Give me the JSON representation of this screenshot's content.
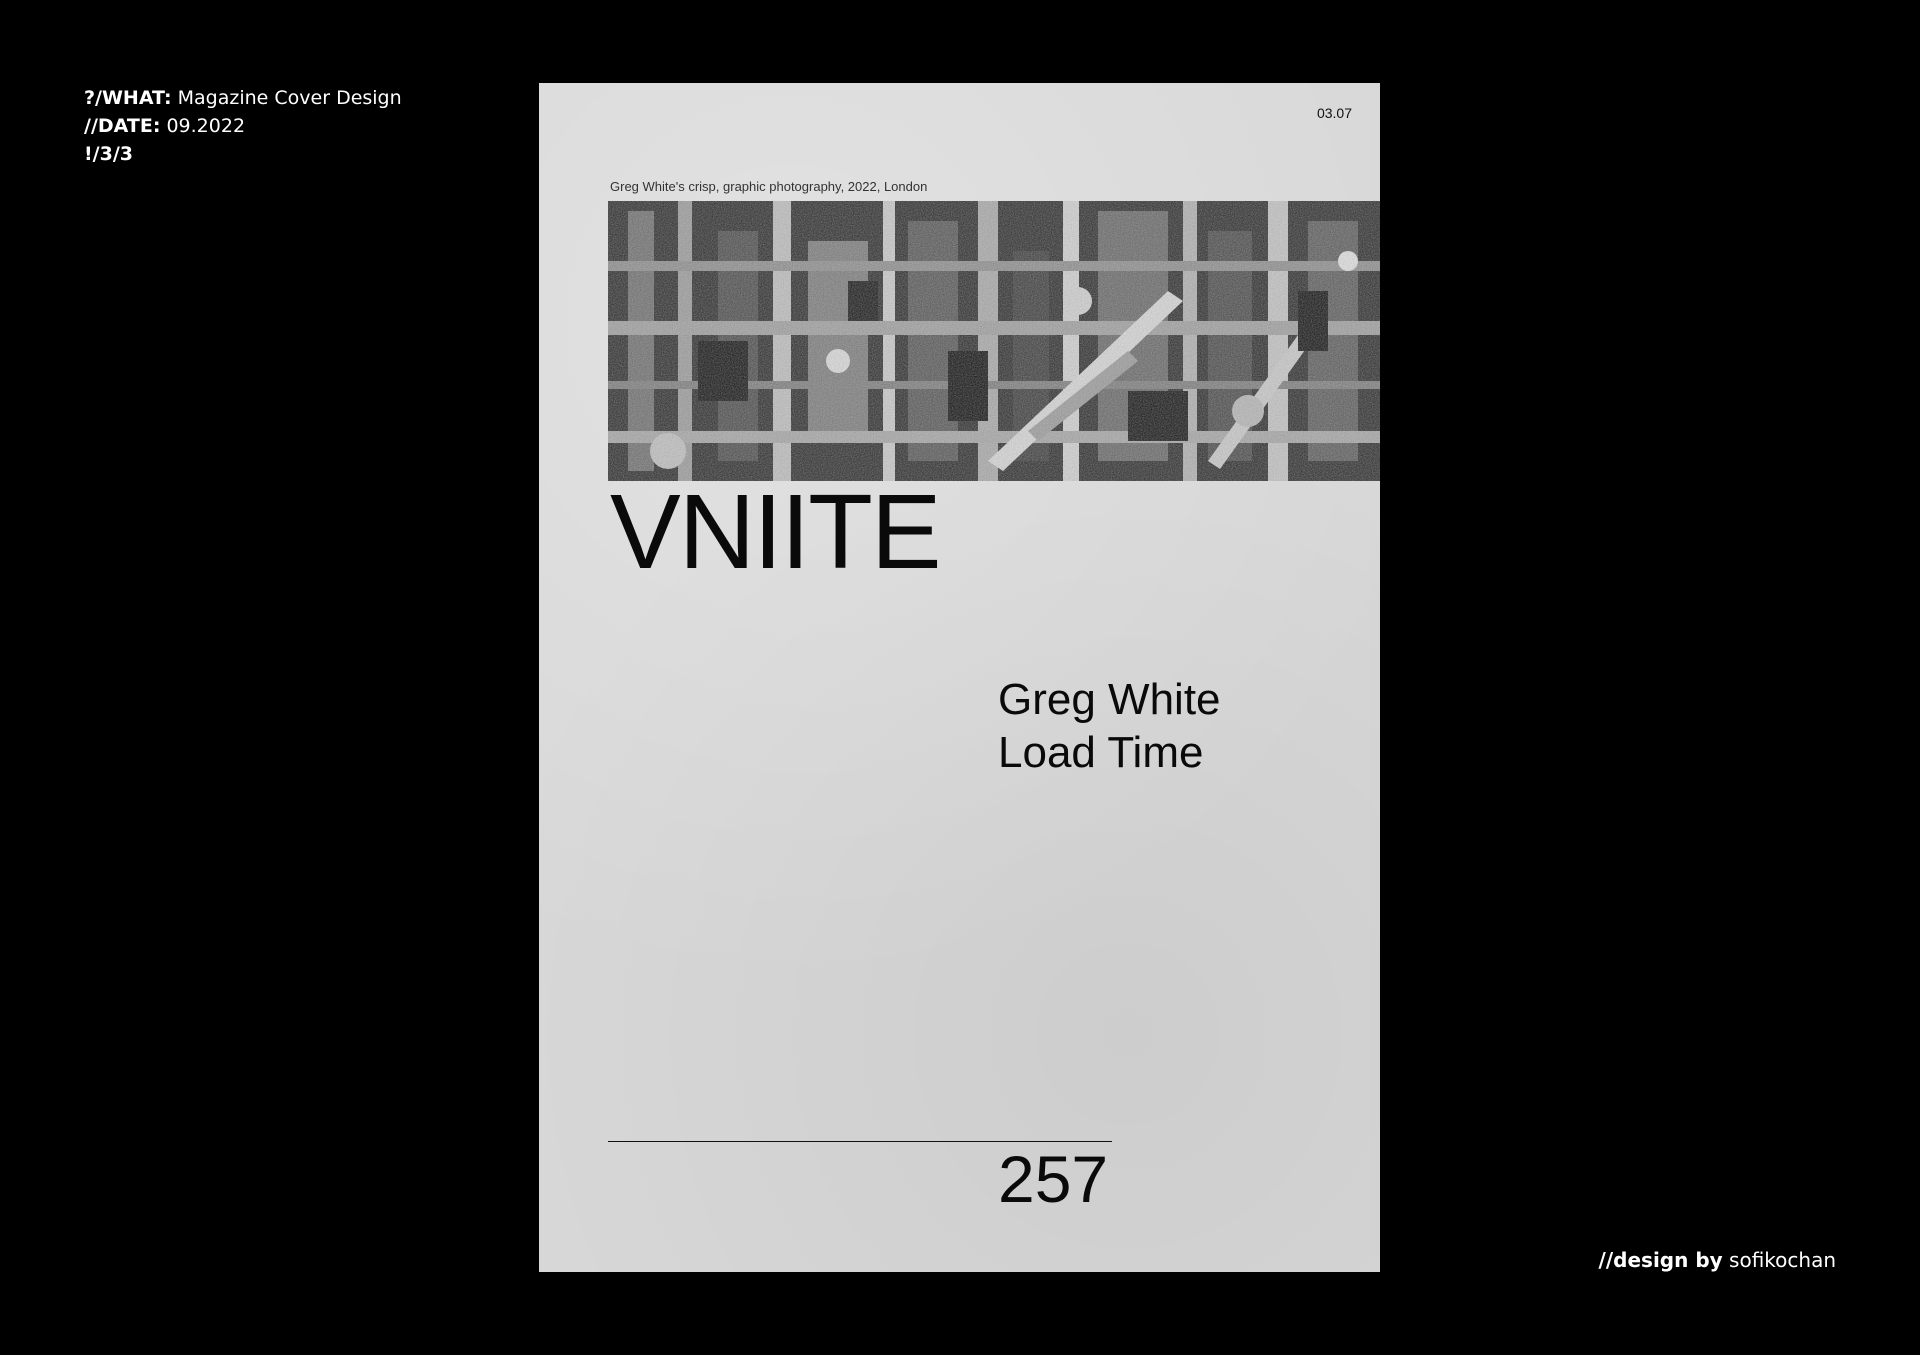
{
  "meta": {
    "what_label": "?/WHAT:",
    "what_value": "Magazine Cover Design",
    "date_label": "//DATE:",
    "date_value": "09.2022",
    "page_index": "!/3/3"
  },
  "credit": {
    "label": "//design by",
    "author": "sofikochan"
  },
  "cover": {
    "issue_date": "03.07",
    "caption": "Greg White's crisp, graphic photography, 2022, London",
    "photo_icon": "industrial-machinery-photo",
    "masthead": "VNIITE",
    "headline_line1": "Greg White",
    "headline_line2": "Load Time",
    "issue_number": "257"
  },
  "colors": {
    "background": "#000000",
    "cover_paper": "#d8d8d8",
    "ink": "#0a0a0a",
    "meta_text": "#ffffff"
  }
}
